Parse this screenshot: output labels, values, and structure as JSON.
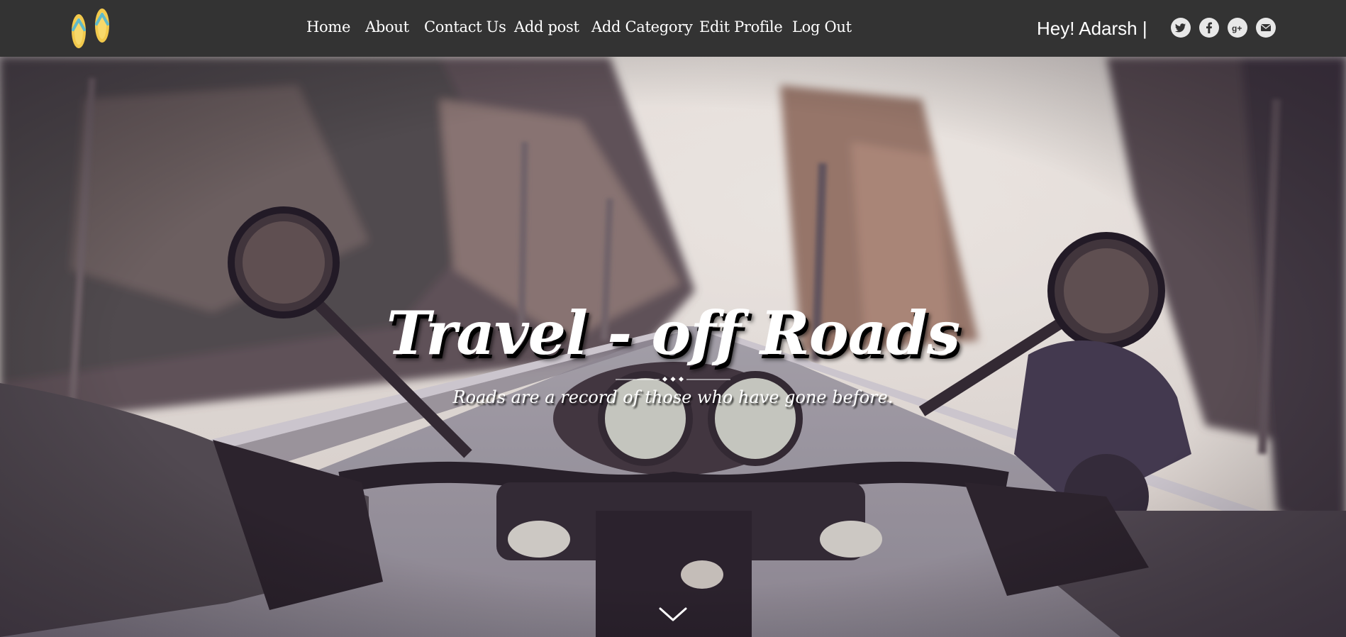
{
  "nav": {
    "links": [
      {
        "label": "Home"
      },
      {
        "label": "About"
      },
      {
        "label": "Contact Us"
      },
      {
        "label": "Add post"
      },
      {
        "label": "Add Category"
      },
      {
        "label": "Edit Profile"
      },
      {
        "label": "Log Out"
      }
    ],
    "greeting": "Hey! Adarsh |",
    "social_icons": [
      "twitter-icon",
      "facebook-icon",
      "google-plus-icon",
      "mail-icon"
    ]
  },
  "hero": {
    "title": "Travel - off Roads",
    "subtitle": "Roads are a record of those who have gone before."
  },
  "colors": {
    "navbar": "#333333",
    "logo_yellow": "#f2c94c",
    "logo_teal": "#5fb9c9",
    "text": "#ffffff"
  }
}
